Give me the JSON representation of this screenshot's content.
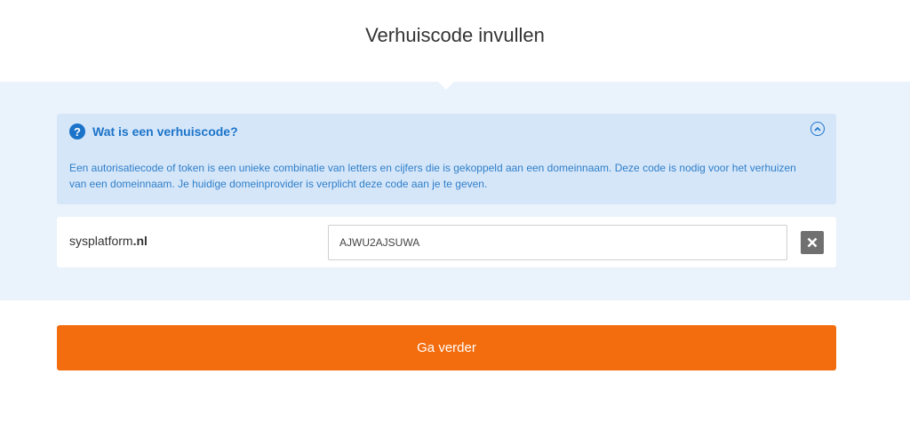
{
  "page": {
    "title": "Verhuiscode invullen"
  },
  "info": {
    "title": "Wat is een verhuiscode?",
    "icon": "question-circle-icon",
    "collapse_icon": "chevron-up-circle-icon",
    "text": "Een autorisatiecode of token is een unieke combinatie van letters en cijfers die is gekoppeld aan een domeinnaam. Deze code is nodig voor het verhuizen van een domeinnaam. Je huidige domeinprovider is verplicht deze code aan je te geven."
  },
  "domain": {
    "name": "sysplatform",
    "tld": ".nl",
    "code_value": "AJWU2AJSUWA",
    "clear_icon": "close-icon"
  },
  "actions": {
    "continue_label": "Ga verder"
  },
  "colors": {
    "accent_blue": "#1b74c9",
    "button_orange": "#f36c0d",
    "panel_bg": "#eaf2fc",
    "info_bg": "#d6e6f9"
  }
}
